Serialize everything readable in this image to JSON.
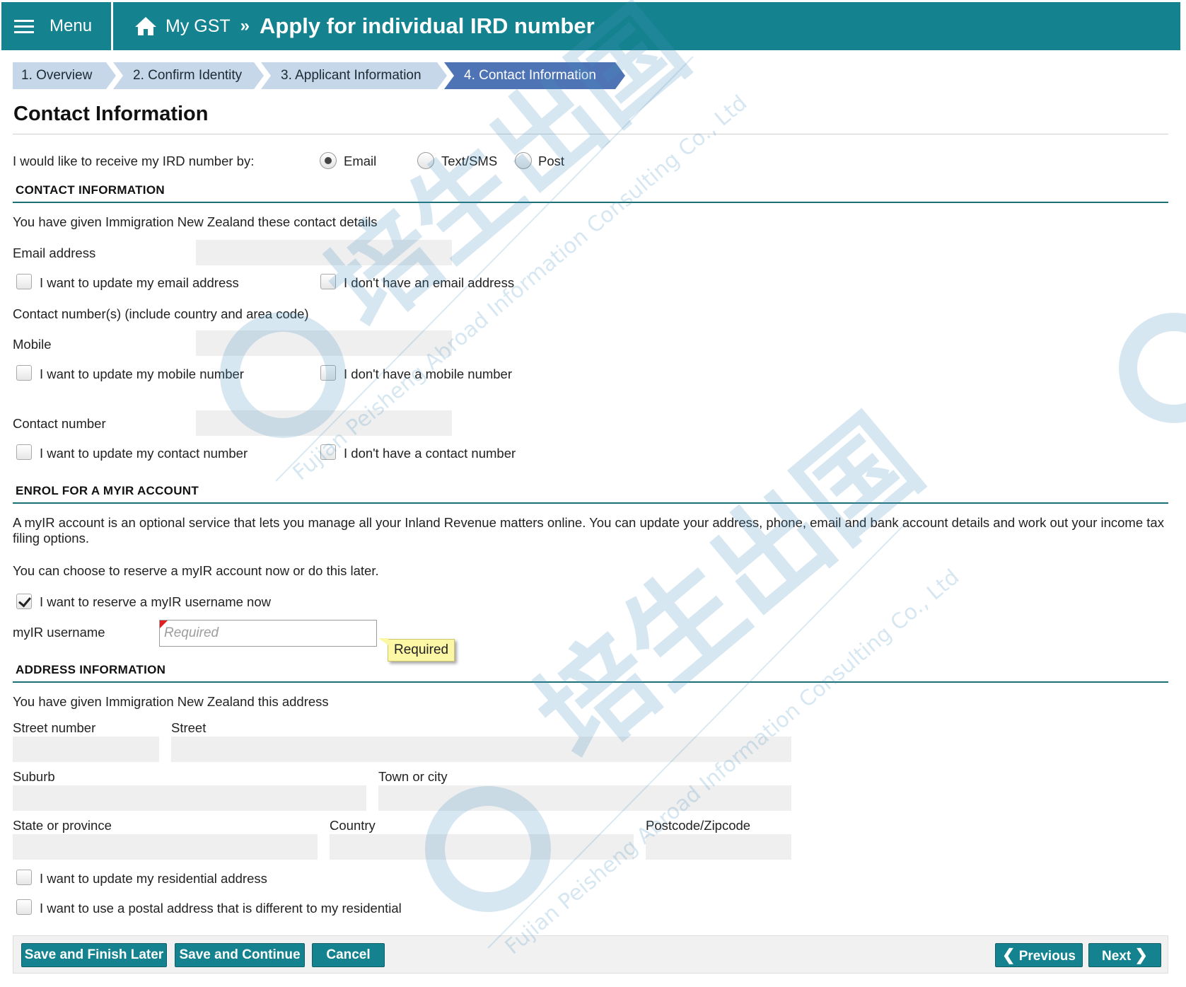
{
  "header": {
    "menu_label": "Menu",
    "home_label": "My GST",
    "separator": "»",
    "title": "Apply for individual IRD number",
    "accent_color": "#14828f"
  },
  "steps": [
    {
      "label": "1. Overview",
      "active": false
    },
    {
      "label": "2. Confirm Identity",
      "active": false
    },
    {
      "label": "3. Applicant Information",
      "active": false
    },
    {
      "label": "4. Contact Information",
      "active": true
    }
  ],
  "page_title": "Contact Information",
  "receive": {
    "label": "I would like to receive my IRD number by:",
    "options": [
      {
        "label": "Email",
        "selected": true
      },
      {
        "label": "Text/SMS",
        "selected": false
      },
      {
        "label": "Post",
        "selected": false
      }
    ]
  },
  "contact": {
    "heading": "CONTACT INFORMATION",
    "intro": "You have given Immigration New Zealand these contact details",
    "email_label": "Email address",
    "email_value": "",
    "update_email": "I want to update my email address",
    "no_email": "I don't have an email address",
    "numbers_label": "Contact number(s) (include country and area code)",
    "mobile_label": "Mobile",
    "mobile_value": "",
    "update_mobile": "I want to update my mobile number",
    "no_mobile": "I don't have a mobile number",
    "contact_label": "Contact number",
    "contact_value": "",
    "update_contact": "I want to update my contact number",
    "no_contact": "I don't have a contact number"
  },
  "myir": {
    "heading": "ENROL FOR A MYIR ACCOUNT",
    "description": "A myIR account is an optional service that lets you manage all your Inland Revenue matters online. You can update your address, phone, email and bank account details and work out your income tax filing options.",
    "choose_text": "You can choose to reserve a myIR account now or do this later.",
    "reserve_label": "I want to reserve a myIR username now",
    "reserve_checked": true,
    "username_label": "myIR username",
    "username_placeholder": "Required",
    "tooltip": "Required"
  },
  "address": {
    "heading": "ADDRESS INFORMATION",
    "intro": "You have given Immigration New Zealand this address",
    "street_number_label": "Street number",
    "street_label": "Street",
    "suburb_label": "Suburb",
    "town_label": "Town or city",
    "state_label": "State or province",
    "country_label": "Country",
    "postcode_label": "Postcode/Zipcode",
    "update_residential": "I want to update my residential address",
    "postal_different": "I want to use a postal address that is different to my residential"
  },
  "footer": {
    "save_finish_later": "Save and Finish Later",
    "save_continue": "Save and Continue",
    "cancel": "Cancel",
    "previous": "Previous",
    "next": "Next"
  },
  "watermark": {
    "chinese": "培生出国",
    "english": "Fujian Peisheng Abroad Information Consulting Co., Ltd"
  }
}
